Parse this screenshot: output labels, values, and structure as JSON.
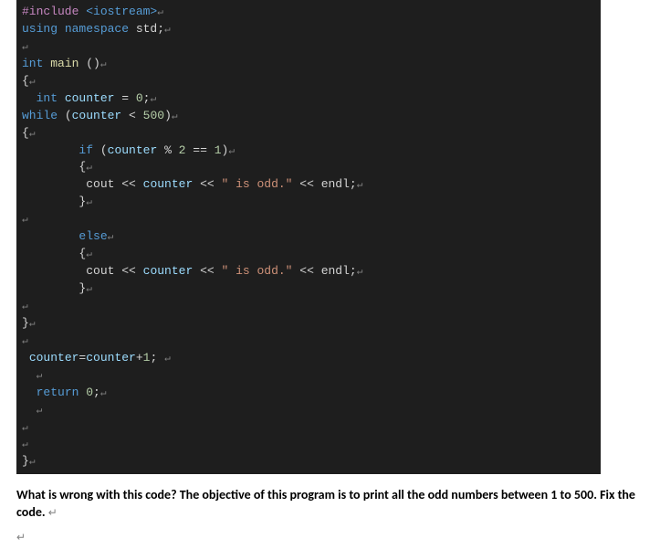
{
  "code": {
    "lines": [
      {
        "tokens": [
          {
            "t": "#include ",
            "c": "tok-pp"
          },
          {
            "t": "<iostream>",
            "c": "tok-inc"
          }
        ]
      },
      {
        "tokens": [
          {
            "t": "using ",
            "c": "tok-kw"
          },
          {
            "t": "namespace ",
            "c": "tok-kw"
          },
          {
            "t": "std",
            "c": "tok-id"
          },
          {
            "t": ";",
            "c": "tok-op"
          }
        ]
      },
      {
        "tokens": []
      },
      {
        "tokens": [
          {
            "t": "int ",
            "c": "tok-type"
          },
          {
            "t": "main ",
            "c": "tok-func"
          },
          {
            "t": "()",
            "c": "tok-op"
          }
        ]
      },
      {
        "tokens": [
          {
            "t": "{",
            "c": "tok-op"
          }
        ]
      },
      {
        "tokens": [
          {
            "t": "  ",
            "c": ""
          },
          {
            "t": "int ",
            "c": "tok-type"
          },
          {
            "t": "counter ",
            "c": "tok-var"
          },
          {
            "t": "= ",
            "c": "tok-op"
          },
          {
            "t": "0",
            "c": "tok-num"
          },
          {
            "t": ";",
            "c": "tok-op"
          }
        ]
      },
      {
        "tokens": [
          {
            "t": "while ",
            "c": "tok-kw"
          },
          {
            "t": "(",
            "c": "tok-op"
          },
          {
            "t": "counter ",
            "c": "tok-var"
          },
          {
            "t": "< ",
            "c": "tok-op"
          },
          {
            "t": "500",
            "c": "tok-num"
          },
          {
            "t": ")",
            "c": "tok-op"
          }
        ]
      },
      {
        "tokens": [
          {
            "t": "{",
            "c": "tok-op"
          }
        ]
      },
      {
        "tokens": [
          {
            "t": "        ",
            "c": ""
          },
          {
            "t": "if ",
            "c": "tok-kw"
          },
          {
            "t": "(",
            "c": "tok-op"
          },
          {
            "t": "counter ",
            "c": "tok-var"
          },
          {
            "t": "% ",
            "c": "tok-op"
          },
          {
            "t": "2 ",
            "c": "tok-num"
          },
          {
            "t": "== ",
            "c": "tok-op"
          },
          {
            "t": "1",
            "c": "tok-num"
          },
          {
            "t": ")",
            "c": "tok-op"
          }
        ]
      },
      {
        "tokens": [
          {
            "t": "        {",
            "c": "tok-op"
          }
        ]
      },
      {
        "tokens": [
          {
            "t": "         ",
            "c": ""
          },
          {
            "t": "cout ",
            "c": "tok-id"
          },
          {
            "t": "<< ",
            "c": "tok-op"
          },
          {
            "t": "counter ",
            "c": "tok-var"
          },
          {
            "t": "<< ",
            "c": "tok-op"
          },
          {
            "t": "\" is odd.\"",
            "c": "tok-str"
          },
          {
            "t": " << ",
            "c": "tok-op"
          },
          {
            "t": "endl",
            "c": "tok-id"
          },
          {
            "t": ";",
            "c": "tok-op"
          }
        ]
      },
      {
        "tokens": [
          {
            "t": "        }",
            "c": "tok-op"
          }
        ]
      },
      {
        "tokens": []
      },
      {
        "tokens": [
          {
            "t": "        ",
            "c": ""
          },
          {
            "t": "else",
            "c": "tok-kw"
          }
        ]
      },
      {
        "tokens": [
          {
            "t": "        {",
            "c": "tok-op"
          }
        ]
      },
      {
        "tokens": [
          {
            "t": "         ",
            "c": ""
          },
          {
            "t": "cout ",
            "c": "tok-id"
          },
          {
            "t": "<< ",
            "c": "tok-op"
          },
          {
            "t": "counter ",
            "c": "tok-var"
          },
          {
            "t": "<< ",
            "c": "tok-op"
          },
          {
            "t": "\" is odd.\"",
            "c": "tok-str"
          },
          {
            "t": " << ",
            "c": "tok-op"
          },
          {
            "t": "endl",
            "c": "tok-id"
          },
          {
            "t": ";",
            "c": "tok-op"
          }
        ]
      },
      {
        "tokens": [
          {
            "t": "        }",
            "c": "tok-op"
          }
        ]
      },
      {
        "tokens": []
      },
      {
        "tokens": [
          {
            "t": "}",
            "c": "tok-op"
          }
        ]
      },
      {
        "tokens": []
      },
      {
        "tokens": [
          {
            "t": " ",
            "c": ""
          },
          {
            "t": "counter",
            "c": "tok-var"
          },
          {
            "t": "=",
            "c": "tok-op"
          },
          {
            "t": "counter",
            "c": "tok-var"
          },
          {
            "t": "+",
            "c": "tok-op"
          },
          {
            "t": "1",
            "c": "tok-num"
          },
          {
            "t": "; ",
            "c": "tok-op"
          }
        ]
      },
      {
        "tokens": [
          {
            "t": "  ",
            "c": ""
          }
        ]
      },
      {
        "tokens": [
          {
            "t": "  ",
            "c": ""
          },
          {
            "t": "return ",
            "c": "tok-kw"
          },
          {
            "t": "0",
            "c": "tok-num"
          },
          {
            "t": ";",
            "c": "tok-op"
          }
        ]
      },
      {
        "tokens": [
          {
            "t": "  ",
            "c": ""
          }
        ]
      },
      {
        "tokens": []
      },
      {
        "tokens": []
      },
      {
        "tokens": [
          {
            "t": "}",
            "c": "tok-op"
          }
        ]
      }
    ],
    "eol_marker": "↵"
  },
  "question": {
    "text": "What is wrong with this code? The objective of this program is to print all the odd numbers between 1 to 500. Fix the code. ",
    "para_mark": "↵"
  },
  "blank_para_mark": "↵"
}
